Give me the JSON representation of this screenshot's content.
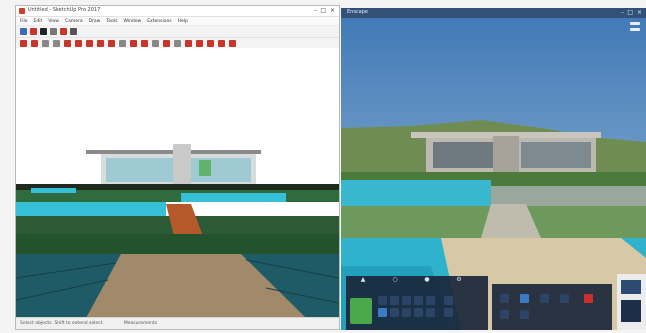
{
  "left_window": {
    "title": "Untitled - SketchUp Pro 2017",
    "menu": [
      "File",
      "Edit",
      "View",
      "Camera",
      "Draw",
      "Tools",
      "Window",
      "Extensions",
      "Help"
    ],
    "status_text": "Select objects. Shift to extend select.",
    "measurements": "Measurements",
    "toolbar_icons": [
      "select-icon",
      "eraser-icon",
      "paint-bucket-icon",
      "line-icon",
      "arc-icon",
      "shapes-icon",
      "push-pull-icon",
      "move-icon",
      "rotate-icon",
      "scale-icon",
      "offset-icon",
      "tape-measure-icon",
      "text-icon",
      "axes-icon",
      "orbit-icon",
      "pan-icon",
      "zoom-icon",
      "zoom-extents-icon",
      "section-icon",
      "warehouse-icon",
      "extension-icon",
      "layout-icon"
    ]
  },
  "right_window": {
    "title": "Enscape",
    "tabs": [
      "person",
      "camera",
      "sun",
      "settings"
    ]
  },
  "colors": {
    "sky_left": "#ffffff",
    "sky_right": "#4f82b8",
    "water": "#36c0d8",
    "grass": "#2f6b3c",
    "path": "#a08a6a",
    "sand": "#d8c9a6",
    "tool_red": "#c8362b",
    "panel_bg": "#1a263a",
    "accent_green": "#4aa84a",
    "accent_red": "#c9302c"
  }
}
